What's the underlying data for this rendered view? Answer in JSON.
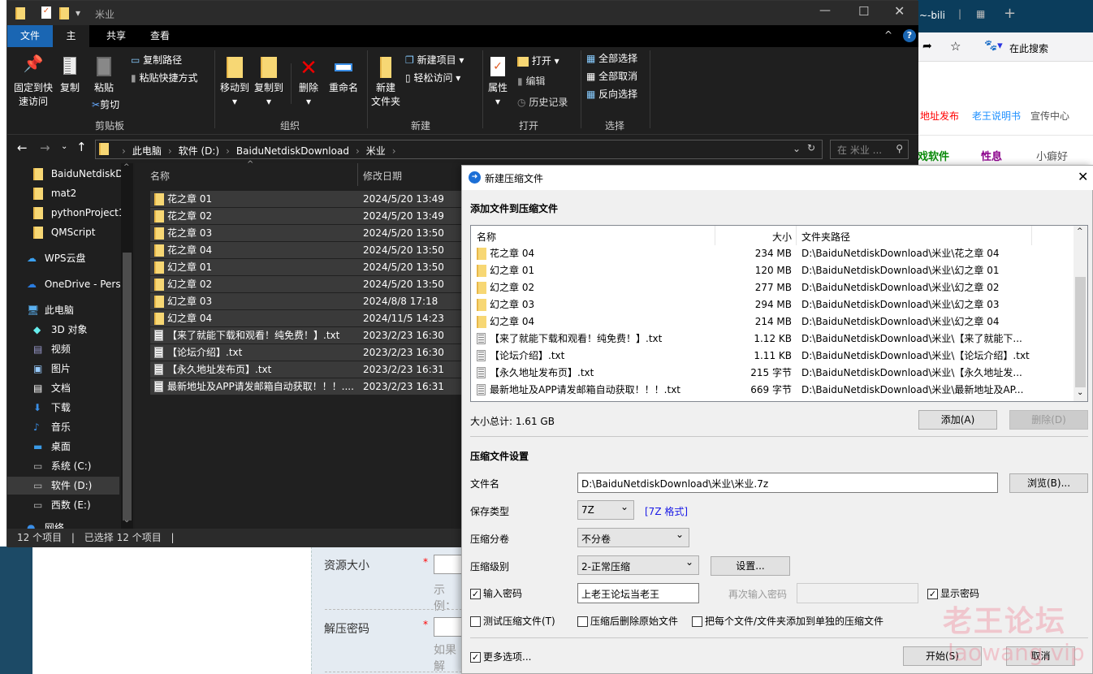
{
  "browser": {
    "tab_text": "~-bili",
    "search_placeholder": "在此搜索",
    "nav": [
      {
        "label": "地址发布",
        "color": "#ff0000"
      },
      {
        "label": "老王说明书",
        "color": "#1e90ff"
      },
      {
        "label": "宣传中心",
        "color": "#555555"
      }
    ],
    "cats": [
      {
        "label": "戏软件",
        "color": "#0a8a0a"
      },
      {
        "label": "性息",
        "color": "#8b008b"
      },
      {
        "label": "小癖好",
        "color": "#555555"
      }
    ],
    "form": {
      "field1": "资源大小",
      "hint1": "示例：",
      "field2": "解压密码",
      "hint2": "如果解",
      "required": "*"
    }
  },
  "explorer": {
    "title": "米业",
    "tabs": [
      "文件",
      "主页",
      "共享",
      "查看"
    ],
    "ribbon": {
      "pin": "固定到快\n速访问",
      "copy": "复制",
      "paste": "粘贴",
      "copy_path": "复制路径",
      "paste_shortcut": "粘贴快捷方式",
      "cut": "剪切",
      "clipboard": "剪贴板",
      "move_to": "移动到",
      "copy_to": "复制到",
      "delete": "删除",
      "rename": "重命名",
      "organize": "组织",
      "new_folder": "新建\n文件夹",
      "new_item": "新建项目",
      "easy_access": "轻松访问",
      "new": "新建",
      "properties": "属性",
      "open": "打开",
      "edit": "编辑",
      "history": "历史记录",
      "open_group": "打开",
      "select_all": "全部选择",
      "select_none": "全部取消",
      "invert": "反向选择",
      "select_group": "选择"
    },
    "breadcrumb": [
      "此电脑",
      "软件 (D:)",
      "BaiduNetdiskDownload",
      "米业"
    ],
    "search_placeholder": "在 米业 ...",
    "nav": [
      {
        "label": "BaiduNetdiskD",
        "icon": "folder",
        "indent": 1
      },
      {
        "label": "mat2",
        "icon": "folder",
        "indent": 1
      },
      {
        "label": "pythonProject1",
        "icon": "folder",
        "indent": 1
      },
      {
        "label": "QMScript",
        "icon": "folder",
        "indent": 1
      },
      {
        "label": "WPS云盘",
        "icon": "cloud",
        "indent": 0
      },
      {
        "label": "OneDrive - Perso",
        "icon": "onedrive",
        "indent": 0
      },
      {
        "label": "此电脑",
        "icon": "computer",
        "indent": 0
      },
      {
        "label": "3D 对象",
        "icon": "cube",
        "indent": 1
      },
      {
        "label": "视频",
        "icon": "video",
        "indent": 1
      },
      {
        "label": "图片",
        "icon": "picture",
        "indent": 1
      },
      {
        "label": "文档",
        "icon": "document",
        "indent": 1
      },
      {
        "label": "下载",
        "icon": "download",
        "indent": 1
      },
      {
        "label": "音乐",
        "icon": "music",
        "indent": 1
      },
      {
        "label": "桌面",
        "icon": "desktop",
        "indent": 1
      },
      {
        "label": "系统 (C:)",
        "icon": "drive",
        "indent": 1
      },
      {
        "label": "软件 (D:)",
        "icon": "drive",
        "indent": 1,
        "selected": true
      },
      {
        "label": "西数 (E:)",
        "icon": "drive",
        "indent": 1
      },
      {
        "label": "网络",
        "icon": "network",
        "indent": 0
      }
    ],
    "columns": {
      "name": "名称",
      "date": "修改日期"
    },
    "files": [
      {
        "name": "花之章 01",
        "date": "2024/5/20 13:49",
        "type": "folder"
      },
      {
        "name": "花之章 02",
        "date": "2024/5/20 13:49",
        "type": "folder"
      },
      {
        "name": "花之章 03",
        "date": "2024/5/20 13:50",
        "type": "folder"
      },
      {
        "name": "花之章 04",
        "date": "2024/5/20 13:50",
        "type": "folder"
      },
      {
        "name": "幻之章 01",
        "date": "2024/5/20 13:50",
        "type": "folder"
      },
      {
        "name": "幻之章 02",
        "date": "2024/5/20 13:50",
        "type": "folder"
      },
      {
        "name": "幻之章 03",
        "date": "2024/8/8 17:18",
        "type": "folder"
      },
      {
        "name": "幻之章 04",
        "date": "2024/11/5 14:23",
        "type": "folder"
      },
      {
        "name": "【来了就能下载和观看！纯免费！】.txt",
        "date": "2023/2/23 16:30",
        "type": "file"
      },
      {
        "name": "【论坛介绍】.txt",
        "date": "2023/2/23 16:30",
        "type": "file"
      },
      {
        "name": "【永久地址发布页】.txt",
        "date": "2023/2/23 16:31",
        "type": "file"
      },
      {
        "name": "最新地址及APP请发邮箱自动获取！！！....",
        "date": "2023/2/23 16:31",
        "type": "file"
      }
    ],
    "status": {
      "count": "12 个项目",
      "selected": "已选择 12 个项目"
    }
  },
  "dialog": {
    "title": "新建压缩文件",
    "add_section": "添加文件到压缩文件",
    "columns": {
      "name": "名称",
      "size": "大小",
      "path": "文件夹路径"
    },
    "files": [
      {
        "name": "花之章 04",
        "size": "234 MB",
        "path": "D:\\BaiduNetdiskDownload\\米业\\花之章 04",
        "type": "folder"
      },
      {
        "name": "幻之章 01",
        "size": "120 MB",
        "path": "D:\\BaiduNetdiskDownload\\米业\\幻之章 01",
        "type": "folder"
      },
      {
        "name": "幻之章 02",
        "size": "277 MB",
        "path": "D:\\BaiduNetdiskDownload\\米业\\幻之章 02",
        "type": "folder"
      },
      {
        "name": "幻之章 03",
        "size": "294 MB",
        "path": "D:\\BaiduNetdiskDownload\\米业\\幻之章 03",
        "type": "folder"
      },
      {
        "name": "幻之章 04",
        "size": "214 MB",
        "path": "D:\\BaiduNetdiskDownload\\米业\\幻之章 04",
        "type": "folder"
      },
      {
        "name": "【来了就能下载和观看！纯免费！】.txt",
        "size": "1.12 KB",
        "path": "D:\\BaiduNetdiskDownload\\米业\\【来了就能下...",
        "type": "file"
      },
      {
        "name": "【论坛介绍】.txt",
        "size": "1.11 KB",
        "path": "D:\\BaiduNetdiskDownload\\米业\\【论坛介绍】.txt",
        "type": "file"
      },
      {
        "name": "【永久地址发布页】.txt",
        "size": "215 字节",
        "path": "D:\\BaiduNetdiskDownload\\米业\\【永久地址发...",
        "type": "file"
      },
      {
        "name": "最新地址及APP请发邮箱自动获取！！！.txt",
        "size": "669 字节",
        "path": "D:\\BaiduNetdiskDownload\\米业\\最新地址及AP...",
        "type": "file"
      }
    ],
    "total": "大小总计: 1.61 GB",
    "add_btn": "添加(A)",
    "delete_btn": "删除(D)",
    "settings_section": "压缩文件设置",
    "filename_label": "文件名",
    "filename": "D:\\BaiduNetdiskDownload\\米业\\米业.7z",
    "browse_btn": "浏览(B)...",
    "type_label": "保存类型",
    "type": "7Z",
    "type_link": "[7Z 格式]",
    "split_label": "压缩分卷",
    "split": "不分卷",
    "level_label": "压缩级别",
    "level": "2-正常压缩",
    "settings_btn": "设置...",
    "password_label": "输入密码",
    "password_checked": true,
    "password": "上老王论坛当老王",
    "repeat_label": "再次输入密码",
    "show_password": "显示密码",
    "show_checked": true,
    "test_label": "测试压缩文件(T)",
    "test_checked": false,
    "delete_after": "压缩后删除原始文件",
    "delete_checked": false,
    "each_file": "把每个文件/文件夹添加到单独的压缩文件",
    "each_checked": false,
    "more_options": "更多选项...",
    "more_checked": true,
    "start_btn": "开始(S)",
    "cancel_btn": "取消"
  },
  "watermark": {
    "text": "老王论坛",
    "url": "laowang.vip"
  }
}
